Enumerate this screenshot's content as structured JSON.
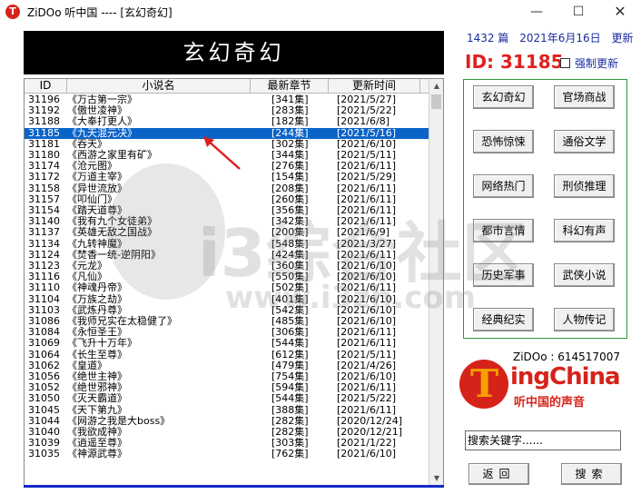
{
  "window": {
    "icon_glyph": "T",
    "title": "ZiDOo 听中国 ---- [玄幻奇幻]",
    "minimize_glyph": "—",
    "maximize_glyph": "☐",
    "close_glyph": "✕"
  },
  "banner": {
    "title": "玄幻奇幻"
  },
  "list": {
    "columns": [
      "ID",
      "小说名",
      "最新章节",
      "更新时间"
    ],
    "scroll_up_glyph": "▲",
    "scroll_down_glyph": "▼",
    "selected_index": 3,
    "rows": [
      [
        "31196",
        "《万古第一宗》",
        "[341集]",
        "[2021/5/27]"
      ],
      [
        "31192",
        "《傲世凌神》",
        "[283集]",
        "[2021/5/22]"
      ],
      [
        "31188",
        "《大奉打更人》",
        "[182集]",
        "[2021/6/8]"
      ],
      [
        "31185",
        "《九天混元决》",
        "[244集]",
        "[2021/5/16]"
      ],
      [
        "31181",
        "《吞天》",
        "[302集]",
        "[2021/6/10]"
      ],
      [
        "31180",
        "《西游之家里有矿》",
        "[344集]",
        "[2021/5/11]"
      ],
      [
        "31174",
        "《沧元图》",
        "[276集]",
        "[2021/6/11]"
      ],
      [
        "31172",
        "《万道主宰》",
        "[154集]",
        "[2021/5/29]"
      ],
      [
        "31158",
        "《异世流放》",
        "[208集]",
        "[2021/6/11]"
      ],
      [
        "31157",
        "《叩仙门》",
        "[260集]",
        "[2021/6/11]"
      ],
      [
        "31154",
        "《踏天道尊》",
        "[356集]",
        "[2021/6/11]"
      ],
      [
        "31140",
        "《我有九个女徒弟》",
        "[342集]",
        "[2021/6/11]"
      ],
      [
        "31137",
        "《英雄无敌之国战》",
        "[200集]",
        "[2021/6/9]"
      ],
      [
        "31134",
        "《九转神魔》",
        "[548集]",
        "[2021/3/27]"
      ],
      [
        "31124",
        "《焚香一统-逆阴阳》",
        "[424集]",
        "[2021/6/11]"
      ],
      [
        "31123",
        "《元龙》",
        "[360集]",
        "[2021/6/10]"
      ],
      [
        "31116",
        "《凡仙》",
        "[550集]",
        "[2021/6/10]"
      ],
      [
        "31110",
        "《神魂丹帝》",
        "[502集]",
        "[2021/6/11]"
      ],
      [
        "31104",
        "《万族之劫》",
        "[401集]",
        "[2021/6/10]"
      ],
      [
        "31103",
        "《武炼丹尊》",
        "[542集]",
        "[2021/6/10]"
      ],
      [
        "31086",
        "《我师兄实在太稳健了》",
        "[485集]",
        "[2021/6/10]"
      ],
      [
        "31084",
        "《永恒圣王》",
        "[306集]",
        "[2021/6/11]"
      ],
      [
        "31069",
        "《飞升十万年》",
        "[544集]",
        "[2021/6/11]"
      ],
      [
        "31064",
        "《长生至尊》",
        "[612集]",
        "[2021/5/11]"
      ],
      [
        "31062",
        "《皇道》",
        "[479集]",
        "[2021/4/26]"
      ],
      [
        "31056",
        "《绝世主神》",
        "[754集]",
        "[2021/6/10]"
      ],
      [
        "31052",
        "《绝世邪神》",
        "[594集]",
        "[2021/6/11]"
      ],
      [
        "31050",
        "《灭天霸道》",
        "[544集]",
        "[2021/5/22]"
      ],
      [
        "31045",
        "《天下第九》",
        "[388集]",
        "[2021/6/11]"
      ],
      [
        "31044",
        "《网游之我是大boss》",
        "[282集]",
        "[2020/12/24]"
      ],
      [
        "31040",
        "《我欲成神》",
        "[282集]",
        "[2020/12/21]"
      ],
      [
        "31039",
        "《逍遥至尊》",
        "[303集]",
        "[2021/1/22]"
      ],
      [
        "31035",
        "《神源武尊》",
        "[762集]",
        "[2021/6/10]"
      ]
    ]
  },
  "info": {
    "count_text": "1432 篇",
    "date_text": "2021年6月16日",
    "update_link": "更新",
    "id_label": "ID: 31185",
    "force_update_label": "强制更新",
    "force_update_checked": false
  },
  "categories": [
    "玄幻奇幻",
    "官场商战",
    "恐怖惊悚",
    "通俗文学",
    "网络热门",
    "刑侦推理",
    "都市言情",
    "科幻有声",
    "历史军事",
    "武侠小说",
    "经典纪实",
    "人物传记"
  ],
  "brand": {
    "zidoo_id": "ZiDOo : 614517007",
    "logo_t": "T",
    "logo_word": "ingChina",
    "logo_sub": "听中国的声音"
  },
  "search": {
    "value": "搜索关键字......",
    "back_label": "返回",
    "search_label": "搜索"
  },
  "watermark": {
    "text": "i3综合社区",
    "url": "www.i3zh.com"
  },
  "colors": {
    "selection": "#0a64c8",
    "accent_red": "#e02020",
    "info_blue": "#1a2aa0",
    "panel_border": "#2a9a3a",
    "logo_red": "#d6231a",
    "logo_orange": "#f5a000"
  },
  "icons": [
    "app-logo-icon",
    "checkbox-icon",
    "red-arrow-annotation-icon"
  ]
}
